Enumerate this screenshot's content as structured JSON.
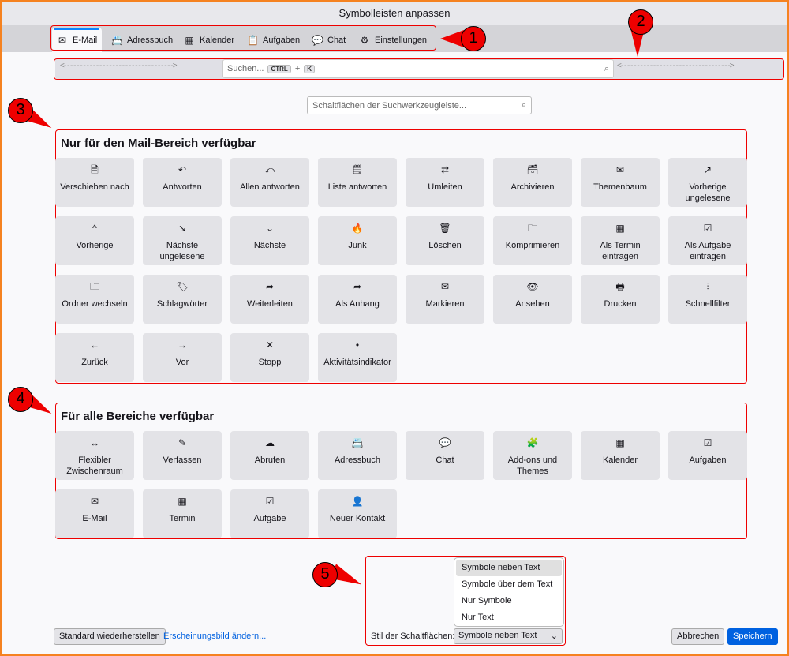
{
  "window": {
    "title": "Symbolleisten anpassen"
  },
  "tabs": [
    {
      "label": "E-Mail",
      "icon": "✉"
    },
    {
      "label": "Adressbuch",
      "icon": "📇"
    },
    {
      "label": "Kalender",
      "icon": "▦"
    },
    {
      "label": "Aufgaben",
      "icon": "📋"
    },
    {
      "label": "Chat",
      "icon": "💬"
    },
    {
      "label": "Einstellungen",
      "icon": "⚙"
    }
  ],
  "toolbar": {
    "search_placeholder": "Suchen...",
    "key1": "CTRL",
    "plus": "+",
    "key2": "K"
  },
  "filter": {
    "placeholder": "Schaltflächen der Suchwerkzeugleiste..."
  },
  "mail_section": {
    "title": "Nur für den Mail-Bereich verfügbar",
    "items": [
      {
        "label": "Verschieben nach",
        "icon": "🗎"
      },
      {
        "label": "Antworten",
        "icon": "↶"
      },
      {
        "label": "Allen antworten",
        "icon": "⤺"
      },
      {
        "label": "Liste antworten",
        "icon": "🗒"
      },
      {
        "label": "Umleiten",
        "icon": "⇄"
      },
      {
        "label": "Archivieren",
        "icon": "🗃"
      },
      {
        "label": "Themenbaum",
        "icon": "✉"
      },
      {
        "label": "Vorherige ungelesene",
        "icon": "↗"
      },
      {
        "label": "Vorherige",
        "icon": "^"
      },
      {
        "label": "Nächste ungelesene",
        "icon": "↘"
      },
      {
        "label": "Nächste",
        "icon": "⌄"
      },
      {
        "label": "Junk",
        "icon": "🔥"
      },
      {
        "label": "Löschen",
        "icon": "🗑"
      },
      {
        "label": "Komprimieren",
        "icon": "🗀"
      },
      {
        "label": "Als Termin eintragen",
        "icon": "▦"
      },
      {
        "label": "Als Aufgabe eintragen",
        "icon": "☑"
      },
      {
        "label": "Ordner wechseln",
        "icon": "🗀"
      },
      {
        "label": "Schlagwörter",
        "icon": "🏷"
      },
      {
        "label": "Weiterleiten",
        "icon": "➦"
      },
      {
        "label": "Als Anhang",
        "icon": "➦"
      },
      {
        "label": "Markieren",
        "icon": "✉"
      },
      {
        "label": "Ansehen",
        "icon": "👁"
      },
      {
        "label": "Drucken",
        "icon": "🖶"
      },
      {
        "label": "Schnellfilter",
        "icon": "⫶"
      },
      {
        "label": "Zurück",
        "icon": "←"
      },
      {
        "label": "Vor",
        "icon": "→"
      },
      {
        "label": "Stopp",
        "icon": "✕"
      },
      {
        "label": "Aktivitätsindikator",
        "icon": "•"
      }
    ]
  },
  "all_section": {
    "title": "Für alle Bereiche verfügbar",
    "items": [
      {
        "label": "Flexibler Zwischenraum",
        "icon": "↔"
      },
      {
        "label": "Verfassen",
        "icon": "✎"
      },
      {
        "label": "Abrufen",
        "icon": "☁"
      },
      {
        "label": "Adressbuch",
        "icon": "📇"
      },
      {
        "label": "Chat",
        "icon": "💬"
      },
      {
        "label": "Add-ons und Themes",
        "icon": "🧩"
      },
      {
        "label": "Kalender",
        "icon": "▦"
      },
      {
        "label": "Aufgaben",
        "icon": "☑"
      },
      {
        "label": "E-Mail",
        "icon": "✉"
      },
      {
        "label": "Termin",
        "icon": "▦"
      },
      {
        "label": "Aufgabe",
        "icon": "☑"
      },
      {
        "label": "Neuer Kontakt",
        "icon": "👤"
      }
    ]
  },
  "style": {
    "label": "Stil der Schaltflächen:",
    "selected": "Symbole neben Text",
    "options": [
      "Symbole neben Text",
      "Symbole über dem Text",
      "Nur Symbole",
      "Nur Text"
    ]
  },
  "buttons": {
    "restore": "Standard wiederherstellen",
    "appearance": "Erscheinungsbild ändern...",
    "cancel": "Abbrechen",
    "save": "Speichern"
  },
  "markers": [
    "1",
    "2",
    "3",
    "4",
    "5"
  ],
  "colors": {
    "accent": "#0a84ff",
    "primary_button": "#0061e0",
    "annotation": "#e00000"
  }
}
